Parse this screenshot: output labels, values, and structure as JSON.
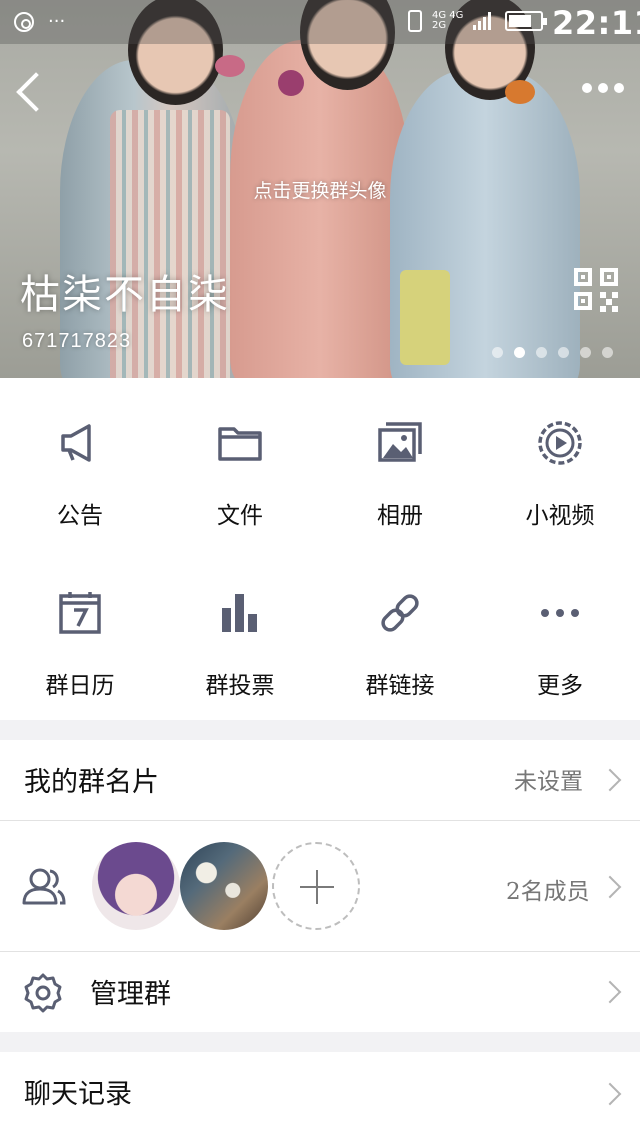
{
  "status_bar": {
    "time": "22:11",
    "network_top": "4G 4G",
    "network_bottom": "2G",
    "overflow": "···"
  },
  "header": {
    "change_avatar_hint": "点击更换群头像",
    "group_name": "枯柒不自柒",
    "group_id": "671717823",
    "carousel_pages": 6,
    "carousel_active_index": 1
  },
  "features": [
    {
      "label": "公告",
      "icon": "megaphone-icon"
    },
    {
      "label": "文件",
      "icon": "folder-icon"
    },
    {
      "label": "相册",
      "icon": "album-icon"
    },
    {
      "label": "小视频",
      "icon": "video-play-icon"
    },
    {
      "label": "群日历",
      "icon": "calendar-icon"
    },
    {
      "label": "群投票",
      "icon": "bar-chart-icon"
    },
    {
      "label": "群链接",
      "icon": "link-icon"
    },
    {
      "label": "更多",
      "icon": "more-dots-icon"
    }
  ],
  "group_card": {
    "title": "我的群名片",
    "value": "未设置"
  },
  "members": {
    "count_label": "2名成员"
  },
  "manage": {
    "title": "管理群"
  },
  "chat_history": {
    "title": "聊天记录"
  },
  "colors": {
    "icon": "#5a5f73",
    "text_primary": "#111111",
    "text_secondary": "#777777",
    "background": "#f2f2f4"
  }
}
